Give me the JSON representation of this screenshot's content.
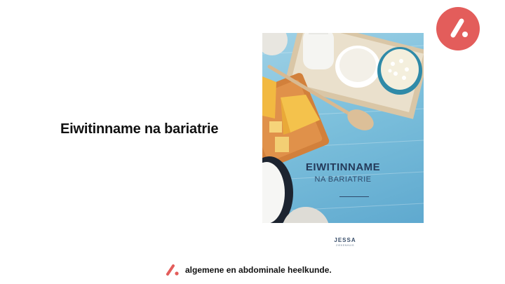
{
  "slide": {
    "title": "Eiwitinname na bariatrie"
  },
  "cover": {
    "title": "EIWITINNAME",
    "subtitle": "NA BARIATRIE"
  },
  "brand": {
    "name": "JESSA",
    "tagline": "ZIEKENHUIS"
  },
  "footer": {
    "text": "algemene en abdominale  heelkunde."
  },
  "icons": {
    "corner_logo": "slash-dot-logo-icon",
    "footer_logo": "slash-dot-logo-icon"
  },
  "colors": {
    "accent": "#e35d5b",
    "cover_background": "#7dc0dc",
    "cover_text": "#243a5a"
  }
}
